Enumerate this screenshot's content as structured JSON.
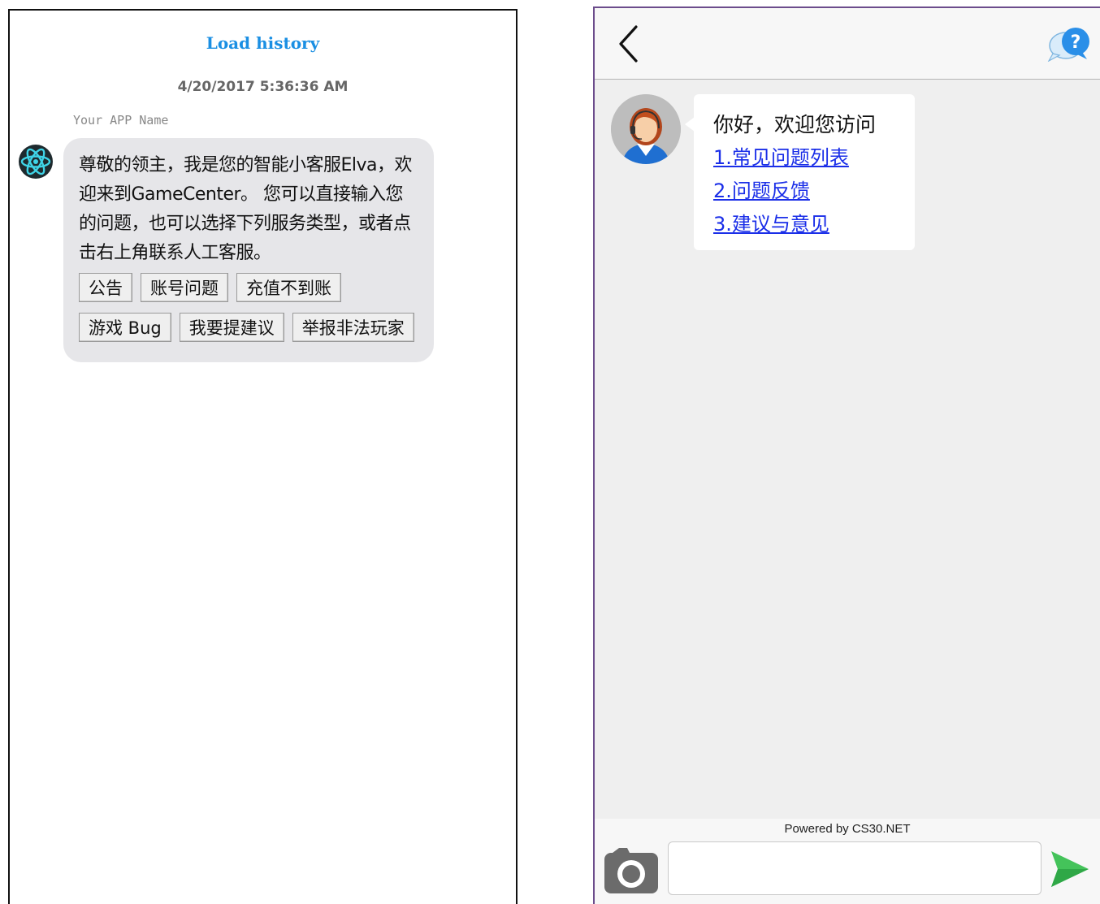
{
  "left_chat": {
    "load_history_label": "Load history",
    "timestamp": "4/20/2017 5:36:36 AM",
    "app_name": "Your APP Name",
    "bot_message": "尊敬的领主，我是您的智能小客服Elva，欢迎来到GameCenter。 您可以直接输入您的问题，也可以选择下列服务类型，或者点击右上角联系人工客服。",
    "options_row1": [
      "公告",
      "账号问题",
      "充值不到账"
    ],
    "options_row2": [
      "游戏 Bug",
      "我要提建议",
      "举报非法玩家"
    ],
    "colors": {
      "link": "#1a8fe3",
      "bubble": "#e6e6e9"
    }
  },
  "right_chat": {
    "greeting": "你好，欢迎您访问",
    "links": [
      "1.常见问题列表",
      "2.问题反馈",
      "3.建议与意见"
    ],
    "powered_by": "Powered by CS30.NET",
    "input_value": "",
    "input_placeholder": "",
    "icons": {
      "back": "chevron-left-icon",
      "help": "help-chat-icon",
      "camera": "camera-icon",
      "send": "send-icon"
    },
    "colors": {
      "link": "#1a2ee8",
      "help": "#2a8fe8",
      "send": "#44c35a",
      "background": "#efefef"
    }
  }
}
